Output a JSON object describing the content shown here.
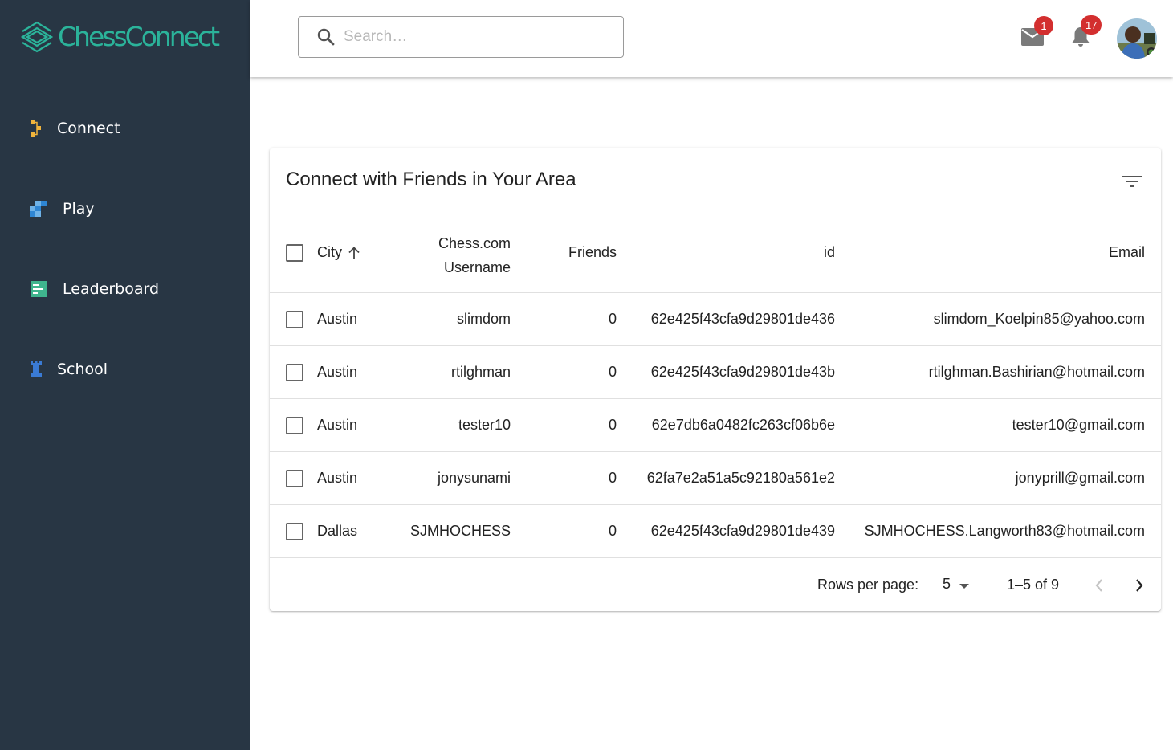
{
  "app": {
    "logo_text": "ChessConnect"
  },
  "sidebar": {
    "items": [
      {
        "label": "Connect",
        "icon": "connect-icon"
      },
      {
        "label": "Play",
        "icon": "play-icon"
      },
      {
        "label": "Leaderboard",
        "icon": "leaderboard-icon"
      },
      {
        "label": "School",
        "icon": "rook-icon"
      }
    ]
  },
  "topbar": {
    "search_placeholder": "Search…",
    "mail_badge": "1",
    "notifications_badge": "17"
  },
  "colors": {
    "sidebar_bg": "#283644",
    "brand": "#2bb39a",
    "badge": "#d32f2f"
  },
  "table": {
    "title": "Connect with Friends in Your Area",
    "headers": {
      "city": "City",
      "username_line1": "Chess.com",
      "username_line2": "Username",
      "friends": "Friends",
      "id": "id",
      "email": "Email"
    },
    "rows": [
      {
        "city": "Austin",
        "username": "slimdom",
        "friends": "0",
        "id": "62e425f43cfa9d29801de436",
        "email": "slimdom_Koelpin85@yahoo.com"
      },
      {
        "city": "Austin",
        "username": "rtilghman",
        "friends": "0",
        "id": "62e425f43cfa9d29801de43b",
        "email": "rtilghman.Bashirian@hotmail.com"
      },
      {
        "city": "Austin",
        "username": "tester10",
        "friends": "0",
        "id": "62e7db6a0482fc263cf06b6e",
        "email": "tester10@gmail.com"
      },
      {
        "city": "Austin",
        "username": "jonysunami",
        "friends": "0",
        "id": "62fa7e2a51a5c92180a561e2",
        "email": "jonyprill@gmail.com"
      },
      {
        "city": "Dallas",
        "username": "SJMHOCHESS",
        "friends": "0",
        "id": "62e425f43cfa9d29801de439",
        "email": "SJMHOCHESS.Langworth83@hotmail.com"
      }
    ],
    "footer": {
      "rows_per_page_label": "Rows per page:",
      "rows_per_page_value": "5",
      "range": "1–5 of 9"
    }
  }
}
